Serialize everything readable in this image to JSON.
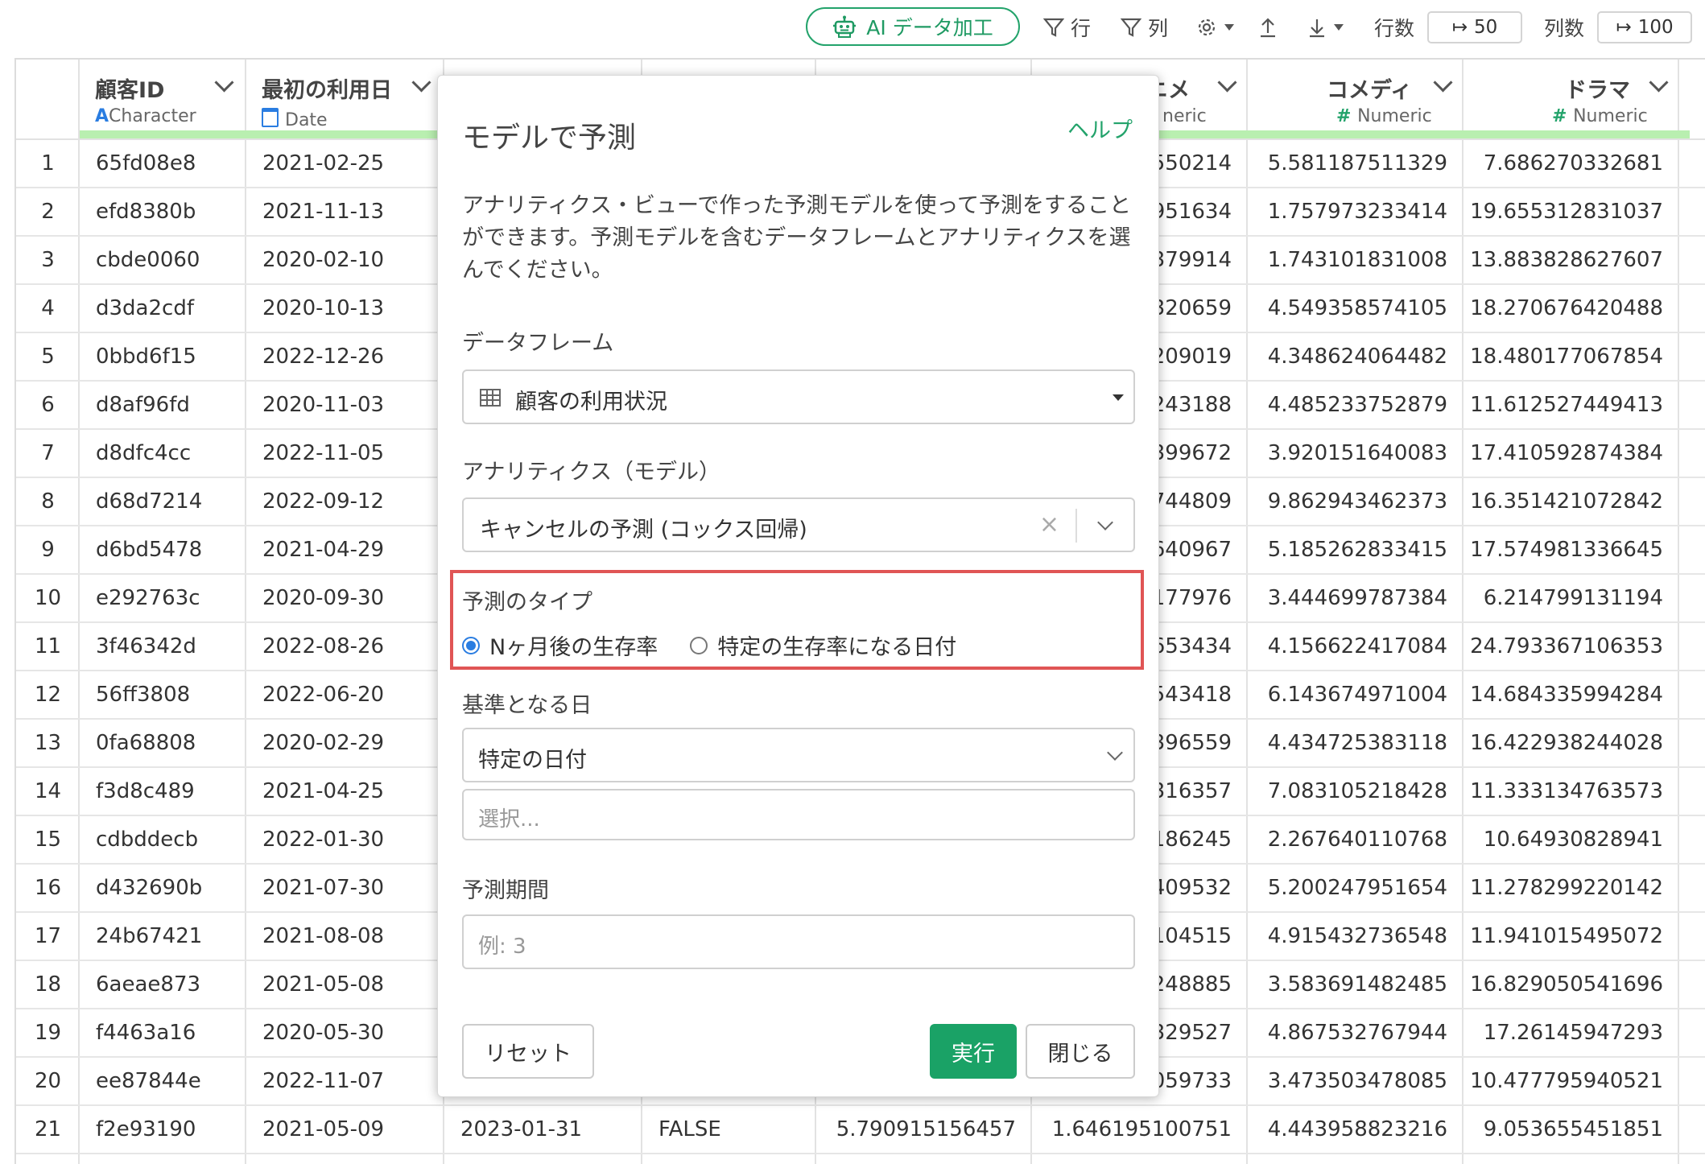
{
  "toolbar": {
    "ai_label": "AI データ加工",
    "filter_row": "行",
    "filter_col": "列",
    "rows_label": "行数",
    "rows_value": "50",
    "cols_label": "列数",
    "cols_value": "100"
  },
  "columns": {
    "c1": {
      "name": "顧客ID",
      "type": "Character"
    },
    "c2": {
      "name": "最初の利用日",
      "type": "Date"
    },
    "c6": {
      "name": "ニメ",
      "type": "neric"
    },
    "c7": {
      "name": "コメディ",
      "type": "Numeric"
    },
    "c8": {
      "name": "ドラマ",
      "type": "Numeric"
    }
  },
  "rows": [
    {
      "n": "1",
      "id": "65fd08e8",
      "date": "2021-02-25",
      "anime": "550214",
      "comedy": "5.581187511329",
      "drama": "7.686270332681"
    },
    {
      "n": "2",
      "id": "efd8380b",
      "date": "2021-11-13",
      "anime": "951634",
      "comedy": "1.757973233414",
      "drama": "19.655312831037"
    },
    {
      "n": "3",
      "id": "cbde0060",
      "date": "2020-02-10",
      "anime": "379914",
      "comedy": "1.743101831008",
      "drama": "13.883828627607"
    },
    {
      "n": "4",
      "id": "d3da2cdf",
      "date": "2020-10-13",
      "anime": "320659",
      "comedy": "4.549358574105",
      "drama": "18.270676420488"
    },
    {
      "n": "5",
      "id": "0bbd6f15",
      "date": "2022-12-26",
      "anime": "209019",
      "comedy": "4.348624064482",
      "drama": "18.480177067854"
    },
    {
      "n": "6",
      "id": "d8af96fd",
      "date": "2020-11-03",
      "anime": "243188",
      "comedy": "4.485233752879",
      "drama": "11.612527449413"
    },
    {
      "n": "7",
      "id": "d8dfc4cc",
      "date": "2022-11-05",
      "anime": "399672",
      "comedy": "3.920151640083",
      "drama": "17.410592874384"
    },
    {
      "n": "8",
      "id": "d68d7214",
      "date": "2022-09-12",
      "anime": "744809",
      "comedy": "9.862943462373",
      "drama": "16.351421072842"
    },
    {
      "n": "9",
      "id": "d6bd5478",
      "date": "2021-04-29",
      "anime": "640967",
      "comedy": "5.185262833415",
      "drama": "17.574981336645"
    },
    {
      "n": "10",
      "id": "e292763c",
      "date": "2020-09-30",
      "anime": "177976",
      "comedy": "3.444699787384",
      "drama": "6.214799131194"
    },
    {
      "n": "11",
      "id": "3f46342d",
      "date": "2022-08-26",
      "anime": "653434",
      "comedy": "4.156622417084",
      "drama": "24.793367106353"
    },
    {
      "n": "12",
      "id": "56ff3808",
      "date": "2022-06-20",
      "anime": "543418",
      "comedy": "6.143674971004",
      "drama": "14.684335994284"
    },
    {
      "n": "13",
      "id": "0fa68808",
      "date": "2020-02-29",
      "anime": "396559",
      "comedy": "4.434725383118",
      "drama": "16.422938244028"
    },
    {
      "n": "14",
      "id": "f3d8c489",
      "date": "2021-04-25",
      "anime": "316357",
      "comedy": "7.083105218428",
      "drama": "11.333134763573"
    },
    {
      "n": "15",
      "id": "cdbddecb",
      "date": "2022-01-30",
      "anime": "186245",
      "comedy": "2.267640110768",
      "drama": "10.64930828941"
    },
    {
      "n": "16",
      "id": "d432690b",
      "date": "2021-07-30",
      "anime": "409532",
      "comedy": "5.200247951654",
      "drama": "11.278299220142"
    },
    {
      "n": "17",
      "id": "24b67421",
      "date": "2021-08-08",
      "anime": "104515",
      "comedy": "4.915432736548",
      "drama": "11.941015495072"
    },
    {
      "n": "18",
      "id": "6aeae873",
      "date": "2021-05-08",
      "anime": "248885",
      "comedy": "3.583691482485",
      "drama": "16.829050541696"
    },
    {
      "n": "19",
      "id": "f4463a16",
      "date": "2020-05-30",
      "anime": "329527",
      "comedy": "4.867532767944",
      "drama": "17.26145947293"
    },
    {
      "n": "20",
      "id": "ee87844e",
      "date": "2022-11-07",
      "anime": "059733",
      "comedy": "3.473503478085",
      "drama": "10.477795940521"
    },
    {
      "n": "21",
      "id": "f2e93190",
      "date": "2021-05-09",
      "c3": "2023-01-31",
      "c4": "FALSE",
      "c5": "5.790915156457",
      "anime": "1.646195100751",
      "comedy": "4.443958823216",
      "drama": "9.053655451851"
    }
  ],
  "modal": {
    "title": "モデルで予測",
    "help": "ヘルプ",
    "description": "アナリティクス・ビューで作った予測モデルを使って予測をすることができます。予測モデルを含むデータフレームとアナリティクスを選んでください。",
    "dataframe_label": "データフレーム",
    "dataframe_value": "顧客の利用状況",
    "analytics_label": "アナリティクス（モデル）",
    "analytics_value": "キャンセルの予測 (コックス回帰)",
    "pred_type_label": "予測のタイプ",
    "pred_type_opt1": "Nヶ月後の生存率",
    "pred_type_opt2": "特定の生存率になる日付",
    "base_date_label": "基準となる日",
    "base_date_value": "特定の日付",
    "base_date_placeholder": "選択...",
    "period_label": "予測期間",
    "period_placeholder": "例: 3",
    "reset": "リセット",
    "run": "実行",
    "close": "閉じる"
  }
}
